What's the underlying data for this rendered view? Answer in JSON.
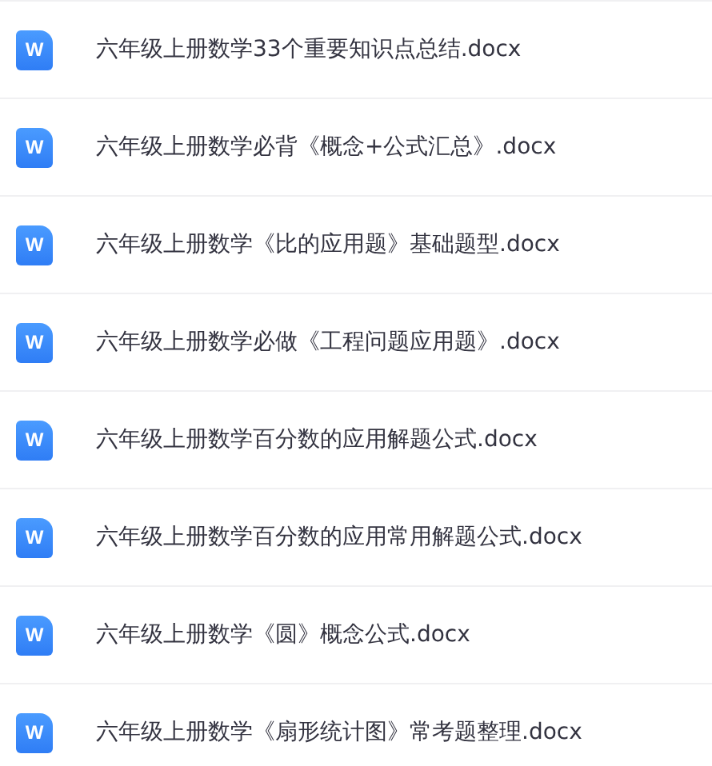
{
  "files": [
    {
      "name": "六年级上册数学33个重要知识点总结.docx",
      "icon_letter": "W"
    },
    {
      "name": "六年级上册数学必背《概念+公式汇总》.docx",
      "icon_letter": "W"
    },
    {
      "name": "六年级上册数学《比的应用题》基础题型.docx",
      "icon_letter": "W"
    },
    {
      "name": "六年级上册数学必做《工程问题应用题》.docx",
      "icon_letter": "W"
    },
    {
      "name": "六年级上册数学百分数的应用解题公式.docx",
      "icon_letter": "W"
    },
    {
      "name": "六年级上册数学百分数的应用常用解题公式.docx",
      "icon_letter": "W"
    },
    {
      "name": "六年级上册数学《圆》概念公式.docx",
      "icon_letter": "W"
    },
    {
      "name": "六年级上册数学《扇形统计图》常考题整理.docx",
      "icon_letter": "W"
    }
  ]
}
